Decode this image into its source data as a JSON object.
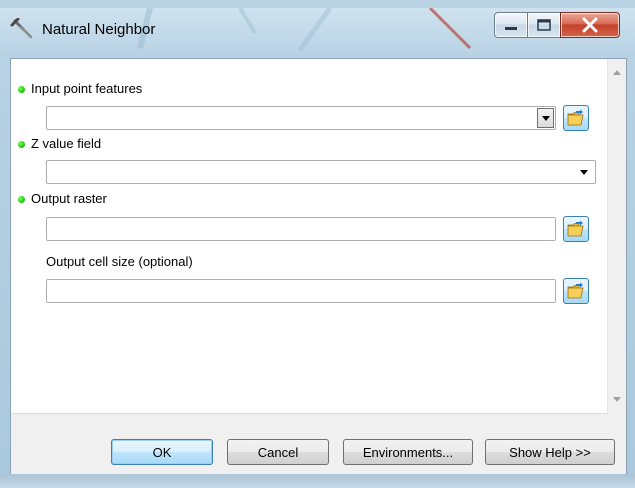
{
  "window": {
    "title": "Natural Neighbor",
    "title_icon": "hammer-tool-icon",
    "controls": [
      "minimize-icon",
      "maximize-icon",
      "close-icon"
    ]
  },
  "parameters": [
    {
      "label": "Input point features",
      "required": true,
      "value": "",
      "control": "combo-with-browse"
    },
    {
      "label": "Z value field",
      "required": true,
      "value": "",
      "control": "dropdown"
    },
    {
      "label": "Output raster",
      "required": true,
      "value": "",
      "control": "text-with-browse"
    },
    {
      "label": "Output cell size (optional)",
      "required": false,
      "value": "",
      "control": "text-with-browse"
    }
  ],
  "buttons": {
    "ok": "OK",
    "cancel": "Cancel",
    "environments": "Environments...",
    "show_help": "Show Help >>"
  },
  "colors": {
    "required_dot": "#23c814",
    "close_button": "#c2422b",
    "default_button_border": "#3c7fb1"
  }
}
